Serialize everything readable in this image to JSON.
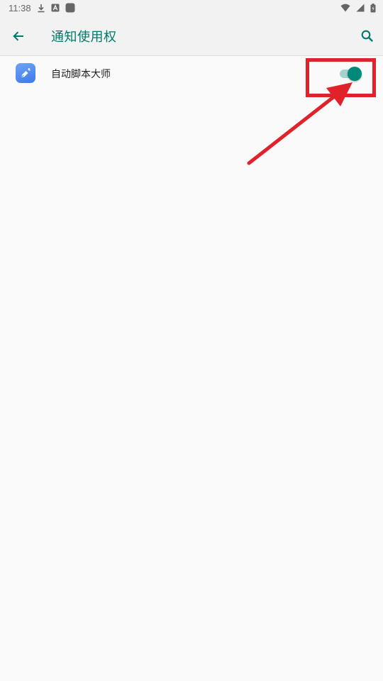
{
  "status_bar": {
    "time": "11:38",
    "icons_left": [
      "download-icon",
      "a-icon",
      "app-square-icon"
    ],
    "icons_right": [
      "wifi-icon",
      "signal-icon",
      "battery-icon"
    ]
  },
  "app_bar": {
    "title": "通知使用权",
    "back_icon": "arrow-back-icon",
    "search_icon": "search-icon"
  },
  "apps": [
    {
      "name": "自动脚本大师",
      "enabled": true,
      "icon": "app-icon"
    }
  ],
  "colors": {
    "accent": "#00796b",
    "switch_thumb": "#00897b",
    "switch_track": "#a6d2cd",
    "annotation": "#e0232b",
    "background": "#fafafa",
    "bar": "#f2f2f2"
  }
}
